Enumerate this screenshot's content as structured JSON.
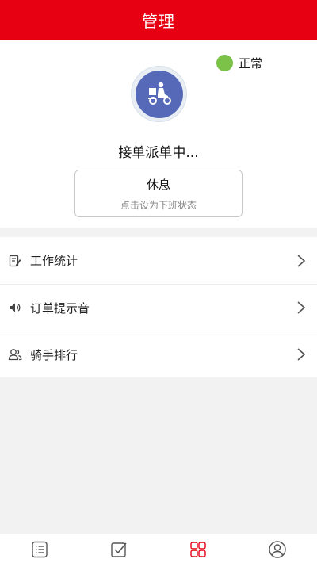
{
  "header": {
    "title": "管理"
  },
  "status": {
    "label": "正常",
    "color": "#7cc148"
  },
  "avatar": {
    "icon": "delivery-rider-icon"
  },
  "work_state": "接单派单中...",
  "rest_button": {
    "title": "休息",
    "subtitle": "点击设为下班状态"
  },
  "menu": [
    {
      "label": "工作统计",
      "icon": "edit-document-icon"
    },
    {
      "label": "订单提示音",
      "icon": "speaker-icon"
    },
    {
      "label": "骑手排行",
      "icon": "users-icon"
    }
  ],
  "tabbar": [
    {
      "icon": "list-icon",
      "active": false
    },
    {
      "icon": "check-box-icon",
      "active": false
    },
    {
      "icon": "grid-icon",
      "active": true
    },
    {
      "icon": "user-icon",
      "active": false
    }
  ],
  "colors": {
    "brand": "#e60012",
    "avatar_bg": "#5569b8"
  }
}
